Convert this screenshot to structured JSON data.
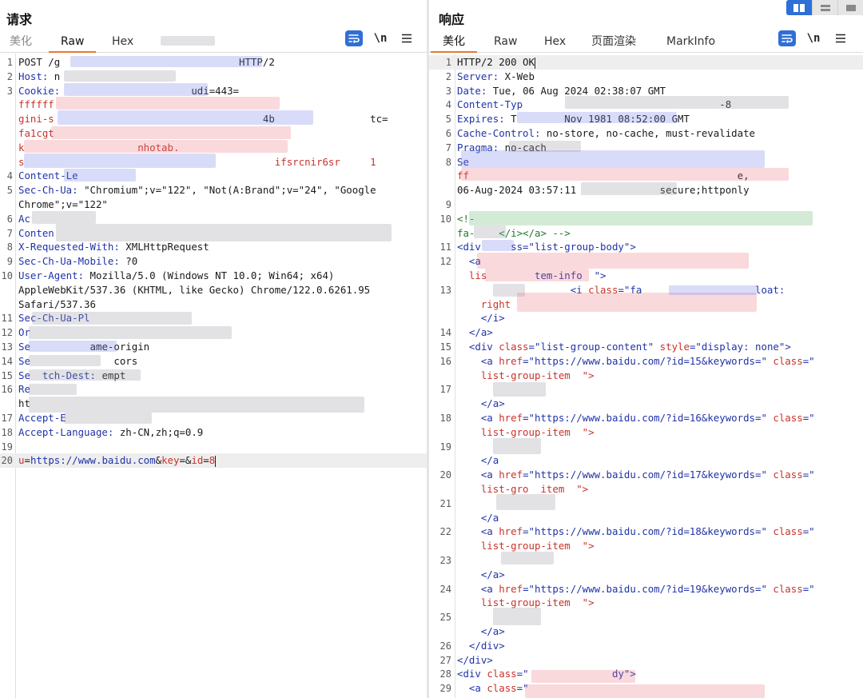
{
  "request": {
    "title": "请求",
    "tabs": [
      "美化",
      "Raw",
      "Hex"
    ],
    "active_tab": "Raw",
    "tools": {
      "newline_label": "\\n"
    },
    "lines": [
      {
        "n": "1",
        "segs": [
          [
            "POST /g",
            "val"
          ],
          [
            "                              ",
            "val"
          ],
          [
            "HTTP/2",
            "val"
          ]
        ]
      },
      {
        "n": "2",
        "segs": [
          [
            "Host:",
            "hk"
          ],
          [
            " n",
            "val"
          ]
        ]
      },
      {
        "n": "3",
        "segs": [
          [
            "Cookie:",
            "hk"
          ],
          [
            "                      udi=443=",
            "val"
          ]
        ]
      },
      {
        "n": "",
        "segs": [
          [
            "ffffff",
            "err"
          ]
        ]
      },
      {
        "n": "",
        "segs": [
          [
            "gini-s",
            "err"
          ],
          [
            "                                   4b                ",
            "val"
          ],
          [
            "tc=",
            "val"
          ]
        ]
      },
      {
        "n": "",
        "segs": [
          [
            "fa1cgt",
            "err"
          ]
        ]
      },
      {
        "n": "",
        "segs": [
          [
            "k",
            "err"
          ],
          [
            "                   nhotab.",
            "err"
          ]
        ]
      },
      {
        "n": "",
        "segs": [
          [
            "s",
            "err"
          ],
          [
            "                                          ifsrcnir6sr",
            "err"
          ],
          [
            "     1",
            "err"
          ]
        ]
      },
      {
        "n": "4",
        "segs": [
          [
            "Content-Le",
            "hk"
          ]
        ]
      },
      {
        "n": "5",
        "segs": [
          [
            "Sec-Ch-Ua:",
            "hk"
          ],
          [
            " \"Chromium\";v=\"122\", \"Not(A:Brand\";v=\"24\", \"Google",
            "val"
          ]
        ]
      },
      {
        "n": "",
        "segs": [
          [
            "Chrome\";v=\"122\"",
            "val"
          ]
        ]
      },
      {
        "n": "6",
        "segs": [
          [
            "Ac",
            "hk"
          ]
        ]
      },
      {
        "n": "7",
        "segs": [
          [
            "Conten",
            "hk"
          ]
        ]
      },
      {
        "n": "8",
        "segs": [
          [
            "X-Requested-With:",
            "hk"
          ],
          [
            " XMLHttpRequest",
            "val"
          ]
        ]
      },
      {
        "n": "9",
        "segs": [
          [
            "Sec-Ch-Ua-Mobile:",
            "hk"
          ],
          [
            " ?0",
            "val"
          ]
        ]
      },
      {
        "n": "10",
        "segs": [
          [
            "User-Agent:",
            "hk"
          ],
          [
            " Mozilla/5.0 (Windows NT 10.0; Win64; x64)",
            "val"
          ]
        ]
      },
      {
        "n": "",
        "segs": [
          [
            "AppleWebKit/537.36 (KHTML, like Gecko) Chrome/122.0.6261.95",
            "val"
          ]
        ]
      },
      {
        "n": "",
        "segs": [
          [
            "Safari/537.36",
            "val"
          ]
        ]
      },
      {
        "n": "11",
        "segs": [
          [
            "Sec-Ch-Ua-Pl",
            "hk"
          ]
        ]
      },
      {
        "n": "12",
        "segs": [
          [
            "Or",
            "hk"
          ]
        ]
      },
      {
        "n": "13",
        "segs": [
          [
            "Se",
            "hk"
          ],
          [
            "          ame-origin",
            "val"
          ]
        ]
      },
      {
        "n": "14",
        "segs": [
          [
            "Se",
            "hk"
          ],
          [
            "              cors",
            "val"
          ]
        ]
      },
      {
        "n": "15",
        "segs": [
          [
            "Se",
            "hk"
          ],
          [
            "  tch-Dest:",
            "hk"
          ],
          [
            " empt",
            "val"
          ]
        ]
      },
      {
        "n": "16",
        "segs": [
          [
            "Re",
            "hk"
          ]
        ]
      },
      {
        "n": "",
        "segs": [
          [
            "ht",
            "val"
          ]
        ]
      },
      {
        "n": "17",
        "segs": [
          [
            "Accept-E",
            "hk"
          ]
        ]
      },
      {
        "n": "18",
        "segs": [
          [
            "Accept-Language:",
            "hk"
          ],
          [
            " zh-CN,zh;q=0.9",
            "val"
          ]
        ]
      },
      {
        "n": "19",
        "segs": [
          [
            "",
            "val"
          ]
        ]
      },
      {
        "n": "20",
        "segs": [
          [
            "u",
            "err"
          ],
          [
            "=",
            "val"
          ],
          [
            "https://www.baidu.com",
            "hk"
          ],
          [
            "&",
            "val"
          ],
          [
            "key",
            "err"
          ],
          [
            "=&",
            "val"
          ],
          [
            "id",
            "err"
          ],
          [
            "=",
            "val"
          ],
          [
            "8",
            "err"
          ]
        ]
      }
    ]
  },
  "response": {
    "title": "响应",
    "tabs": [
      "美化",
      "Raw",
      "Hex",
      "页面渲染",
      "MarkInfo"
    ],
    "active_tab": "美化",
    "tools": {
      "newline_label": "\\n"
    },
    "lines": [
      {
        "n": "1",
        "segs": [
          [
            "HTTP/2 200 OK",
            "val"
          ]
        ]
      },
      {
        "n": "2",
        "segs": [
          [
            "Server:",
            "hk"
          ],
          [
            " X-Web",
            "val"
          ]
        ]
      },
      {
        "n": "3",
        "segs": [
          [
            "Date:",
            "hk"
          ],
          [
            " Tue, 06 Aug 2024 02:38:07 GMT",
            "val"
          ]
        ]
      },
      {
        "n": "4",
        "segs": [
          [
            "Content-Typ",
            "hk"
          ],
          [
            "                                 -8",
            "val"
          ]
        ]
      },
      {
        "n": "5",
        "segs": [
          [
            "Expires:",
            "hk"
          ],
          [
            " T",
            "val"
          ],
          [
            "        Nov 1981 08:52:00 GMT",
            "val"
          ]
        ]
      },
      {
        "n": "6",
        "segs": [
          [
            "Cache-Control:",
            "hk"
          ],
          [
            " no-store, no-cache, must-revalidate",
            "val"
          ]
        ]
      },
      {
        "n": "7",
        "segs": [
          [
            "Pragma:",
            "hk"
          ],
          [
            " no-cach",
            "val"
          ]
        ]
      },
      {
        "n": "8",
        "segs": [
          [
            "Se",
            "hk"
          ],
          [
            "                      ",
            "val"
          ]
        ]
      },
      {
        "n": "",
        "segs": [
          [
            "ff",
            "err"
          ],
          [
            "                                             e,",
            "val"
          ]
        ]
      },
      {
        "n": "",
        "segs": [
          [
            "06-Aug-2024 03:57:11",
            "val"
          ],
          [
            "              secure;httponly",
            "val"
          ]
        ]
      },
      {
        "n": "9",
        "segs": [
          [
            "",
            "val"
          ]
        ]
      },
      {
        "n": "10",
        "segs": [
          [
            "<!-",
            "cmt"
          ]
        ]
      },
      {
        "n": "",
        "segs": [
          [
            "fa-",
            "cmt"
          ],
          [
            "    </i></a> -->",
            "cmt"
          ]
        ]
      },
      {
        "n": "11",
        "segs": [
          [
            "<div",
            "tag"
          ],
          [
            "     ss=\"list-group-body\">",
            "tag"
          ]
        ]
      },
      {
        "n": "12",
        "segs": [
          [
            "  <a",
            "tag"
          ]
        ]
      },
      {
        "n": "",
        "segs": [
          [
            "  lis",
            "err"
          ],
          [
            "        tem-info  \">",
            "str"
          ]
        ]
      },
      {
        "n": "13",
        "segs": [
          [
            "    ",
            "val"
          ],
          [
            "               <i ",
            "tag"
          ],
          [
            "class",
            "attr"
          ],
          [
            "=\"fa",
            "str"
          ],
          [
            "                   loat:",
            "str"
          ]
        ]
      },
      {
        "n": "",
        "segs": [
          [
            "    right",
            "err"
          ]
        ]
      },
      {
        "n": "",
        "segs": [
          [
            "    </i>",
            "tag"
          ]
        ]
      },
      {
        "n": "14",
        "segs": [
          [
            "  </a>",
            "tag"
          ]
        ]
      },
      {
        "n": "15",
        "segs": [
          [
            "  <div ",
            "tag"
          ],
          [
            "class",
            "attr"
          ],
          [
            "=\"list-group-content\" ",
            "str"
          ],
          [
            "style",
            "attr"
          ],
          [
            "=\"display: none\">",
            "str"
          ]
        ]
      },
      {
        "n": "16",
        "segs": [
          [
            "    <a ",
            "tag"
          ],
          [
            "href",
            "attr"
          ],
          [
            "=\"https://www.baidu.com/?id=15&keywords=\" ",
            "str"
          ],
          [
            "class",
            "attr"
          ],
          [
            "=\"",
            "str"
          ]
        ]
      },
      {
        "n": "",
        "segs": [
          [
            "    list-group-item  \">",
            "err"
          ]
        ]
      },
      {
        "n": "17",
        "segs": [
          [
            "",
            "val"
          ]
        ]
      },
      {
        "n": "",
        "segs": [
          [
            "    </a>",
            "tag"
          ]
        ]
      },
      {
        "n": "18",
        "segs": [
          [
            "    <a ",
            "tag"
          ],
          [
            "href",
            "attr"
          ],
          [
            "=\"https://www.baidu.com/?id=16&keywords=\" ",
            "str"
          ],
          [
            "class",
            "attr"
          ],
          [
            "=\"",
            "str"
          ]
        ]
      },
      {
        "n": "",
        "segs": [
          [
            "    list-group-item  \">",
            "err"
          ]
        ]
      },
      {
        "n": "19",
        "segs": [
          [
            "",
            "val"
          ]
        ]
      },
      {
        "n": "",
        "segs": [
          [
            "    </a",
            "tag"
          ]
        ]
      },
      {
        "n": "20",
        "segs": [
          [
            "    <a ",
            "tag"
          ],
          [
            "href",
            "attr"
          ],
          [
            "=\"https://www.baidu.com/?id=17&keywords=\" ",
            "str"
          ],
          [
            "class",
            "attr"
          ],
          [
            "=\"",
            "str"
          ]
        ]
      },
      {
        "n": "",
        "segs": [
          [
            "    list-gro",
            "err"
          ],
          [
            "  item  \">",
            "err"
          ]
        ]
      },
      {
        "n": "21",
        "segs": [
          [
            "",
            "val"
          ]
        ]
      },
      {
        "n": "",
        "segs": [
          [
            "    </a",
            "tag"
          ]
        ]
      },
      {
        "n": "22",
        "segs": [
          [
            "    <a ",
            "tag"
          ],
          [
            "href",
            "attr"
          ],
          [
            "=\"https://www.baidu.com/?id=18&keywords=\" ",
            "str"
          ],
          [
            "class",
            "attr"
          ],
          [
            "=\"",
            "str"
          ]
        ]
      },
      {
        "n": "",
        "segs": [
          [
            "    list-group-item  \">",
            "err"
          ]
        ]
      },
      {
        "n": "23",
        "segs": [
          [
            "",
            "val"
          ]
        ]
      },
      {
        "n": "",
        "segs": [
          [
            "    </a>",
            "tag"
          ]
        ]
      },
      {
        "n": "24",
        "segs": [
          [
            "    <a ",
            "tag"
          ],
          [
            "href",
            "attr"
          ],
          [
            "=\"https://www.baidu.com/?id=19&keywords=\" ",
            "str"
          ],
          [
            "class",
            "attr"
          ],
          [
            "=\"",
            "str"
          ]
        ]
      },
      {
        "n": "",
        "segs": [
          [
            "    list-group-item  \">",
            "err"
          ]
        ]
      },
      {
        "n": "25",
        "segs": [
          [
            "",
            "val"
          ]
        ]
      },
      {
        "n": "",
        "segs": [
          [
            "    </a>",
            "tag"
          ]
        ]
      },
      {
        "n": "26",
        "segs": [
          [
            "  </div>",
            "tag"
          ]
        ]
      },
      {
        "n": "27",
        "segs": [
          [
            "</div>",
            "tag"
          ]
        ]
      },
      {
        "n": "28",
        "segs": [
          [
            "<div ",
            "tag"
          ],
          [
            "class",
            "attr"
          ],
          [
            "=\"",
            "str"
          ],
          [
            "              dy\">",
            "str"
          ]
        ]
      },
      {
        "n": "29",
        "segs": [
          [
            "  <a ",
            "tag"
          ],
          [
            "class",
            "attr"
          ],
          [
            "=\"",
            "str"
          ]
        ]
      }
    ]
  }
}
